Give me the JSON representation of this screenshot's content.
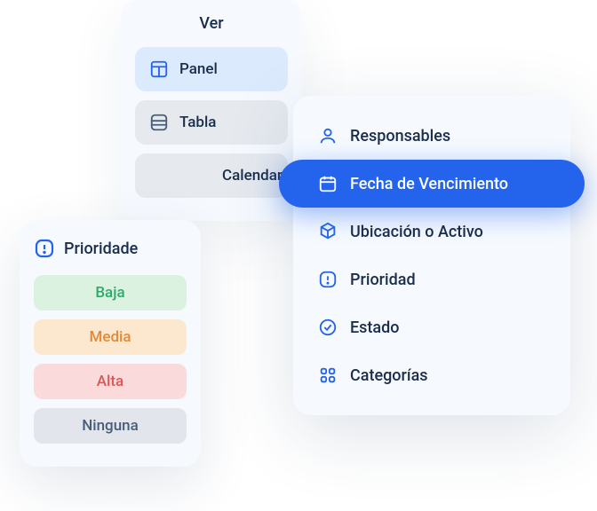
{
  "view_panel": {
    "title": "Ver",
    "options": [
      {
        "label": "Panel",
        "active": true
      },
      {
        "label": "Tabla",
        "active": false
      },
      {
        "label": "Calendario",
        "active": false
      }
    ]
  },
  "priority_panel": {
    "title": "Prioridade",
    "levels": {
      "baja": "Baja",
      "media": "Media",
      "alta": "Alta",
      "ninguna": "Ninguna"
    }
  },
  "filter_panel": {
    "items": {
      "responsables": "Responsables",
      "fecha": "Fecha de Vencimiento",
      "ubicacion": "Ubicación o Activo",
      "prioridad": "Prioridad",
      "estado": "Estado",
      "categorias": "Categorías"
    }
  }
}
